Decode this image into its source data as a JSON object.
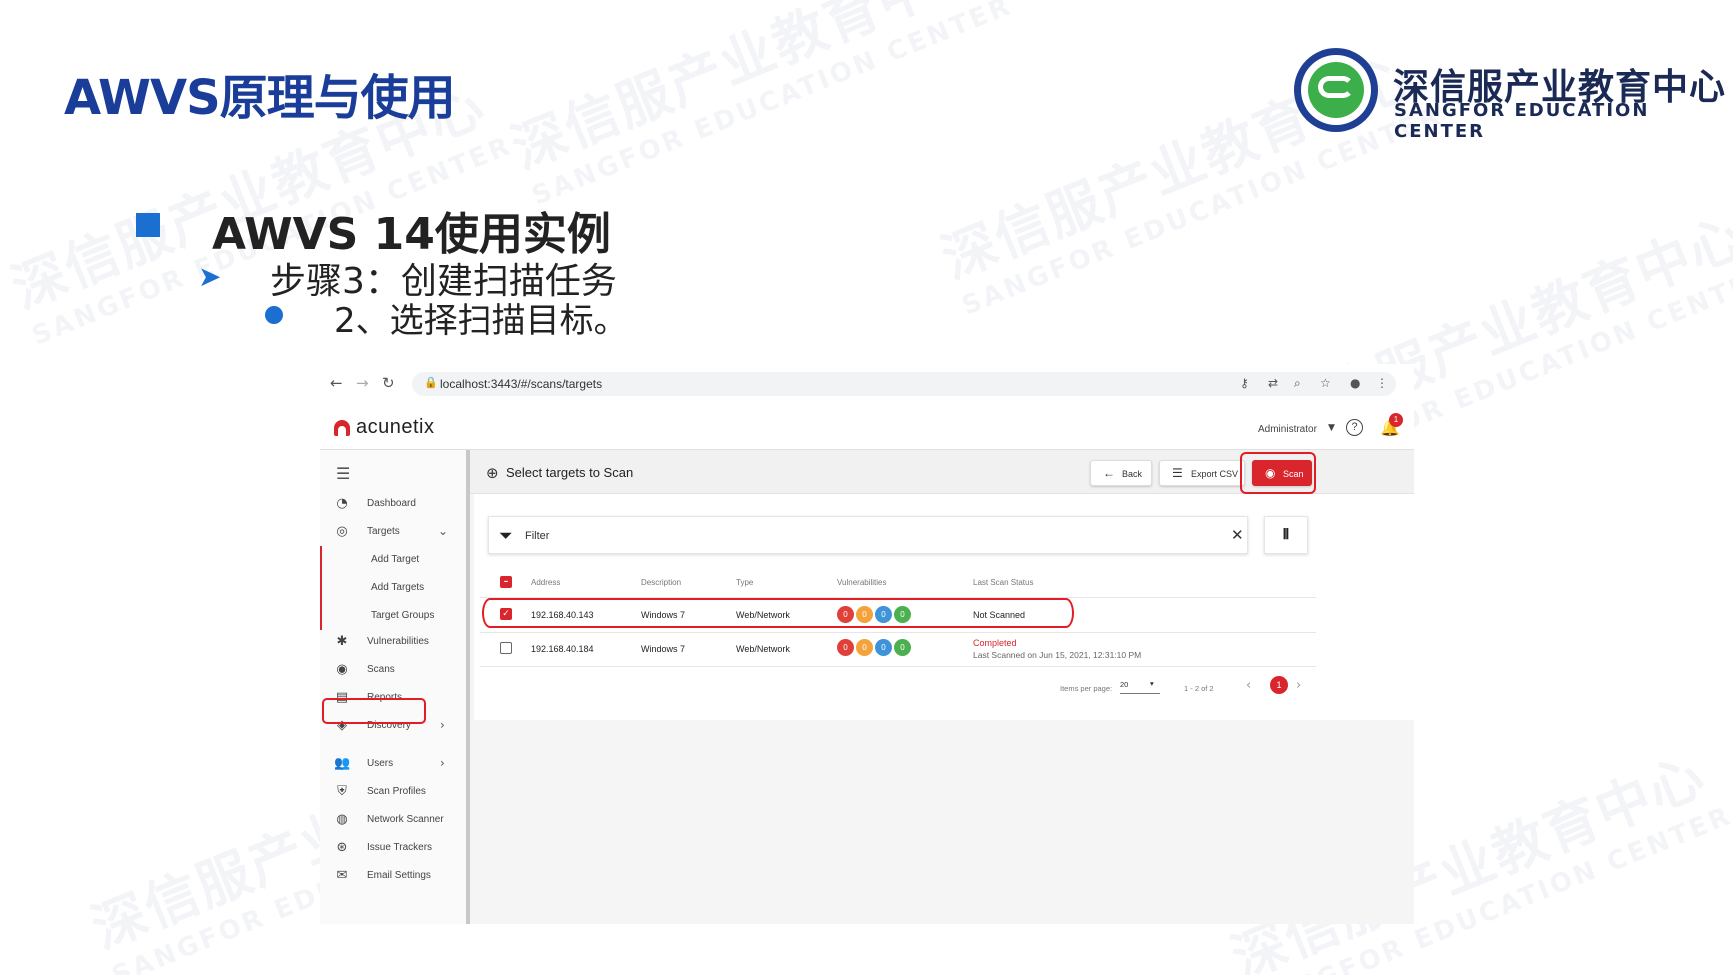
{
  "slide": {
    "title": "AWVS原理与使用",
    "heading": "AWVS 14使用实例",
    "step": "步骤3：创建扫描任务",
    "substep": "2、选择扫描目标。"
  },
  "org": {
    "name_cn": "深信服产业教育中心",
    "name_en": "SANGFOR EDUCATION CENTER",
    "watermark_cn": "深信服产业教育中心",
    "watermark_en": "SANGFOR EDUCATION CENTER"
  },
  "browser": {
    "url": "localhost:3443/#/scans/targets"
  },
  "app": {
    "brand": "acunetix",
    "user": "Administrator",
    "notification_count": "1",
    "help_glyph": "?"
  },
  "sidebar": {
    "items": [
      {
        "label": "Dashboard",
        "icon": "dashboard-icon"
      },
      {
        "label": "Targets",
        "icon": "target-icon"
      },
      {
        "label": "Add Target"
      },
      {
        "label": "Add Targets"
      },
      {
        "label": "Target Groups"
      },
      {
        "label": "Vulnerabilities",
        "icon": "bug-icon"
      },
      {
        "label": "Scans",
        "icon": "scan-icon"
      },
      {
        "label": "Reports",
        "icon": "report-icon"
      },
      {
        "label": "Discovery",
        "icon": "compass-icon"
      },
      {
        "label": "Users",
        "icon": "users-icon"
      },
      {
        "label": "Scan Profiles",
        "icon": "shield-icon"
      },
      {
        "label": "Network Scanner",
        "icon": "radar-icon"
      },
      {
        "label": "Issue Trackers",
        "icon": "tracker-icon"
      },
      {
        "label": "Email Settings",
        "icon": "email-icon"
      }
    ]
  },
  "toolbar": {
    "title": "Select targets to Scan",
    "back_label": "Back",
    "export_label": "Export CSV",
    "scan_label": "Scan"
  },
  "filter": {
    "label": "Filter"
  },
  "table": {
    "columns": [
      "Address",
      "Description",
      "Type",
      "Vulnerabilities",
      "Last Scan Status"
    ],
    "rows": [
      {
        "selected": true,
        "address": "192.168.40.143",
        "description": "Windows 7",
        "type": "Web/Network",
        "vulns": [
          "0",
          "0",
          "0",
          "0"
        ],
        "status": "Not Scanned",
        "last_scanned": ""
      },
      {
        "selected": false,
        "address": "192.168.40.184",
        "description": "Windows 7",
        "type": "Web/Network",
        "vulns": [
          "0",
          "0",
          "0",
          "0"
        ],
        "status": "Completed",
        "last_scanned": "Last Scanned on Jun 15, 2021, 12:31:10 PM"
      }
    ]
  },
  "pagination": {
    "items_per_page_label": "Items per page:",
    "items_per_page": "20",
    "range": "1 - 2 of 2",
    "current_page": "1"
  },
  "colors": {
    "accent": "#d8262c",
    "title_blue": "#1a3d99",
    "bullet_blue": "#1a6fd0",
    "vuln_critical": "#e0403a",
    "vuln_high": "#f3a33a",
    "vuln_medium": "#3f93d9",
    "vuln_low": "#4caf50"
  }
}
